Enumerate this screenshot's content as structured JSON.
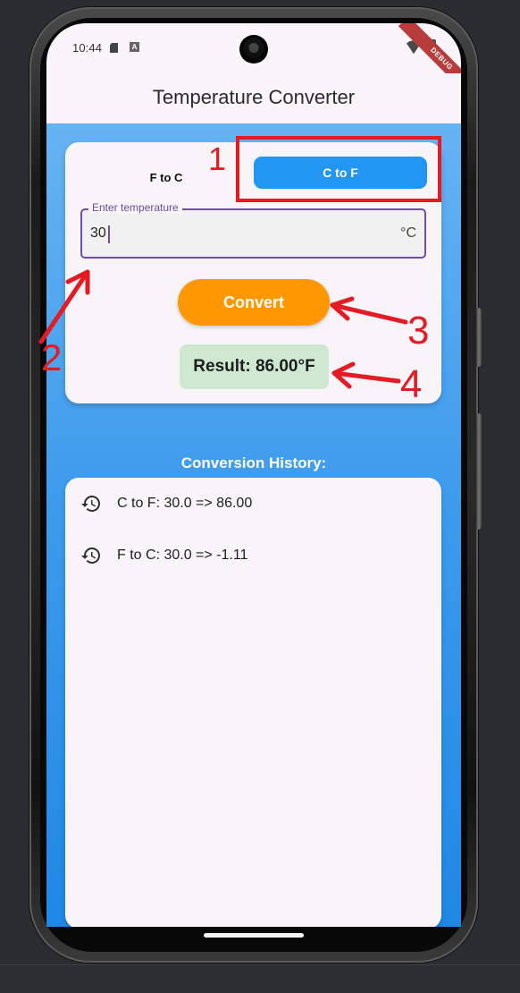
{
  "status_bar": {
    "time": "10:44",
    "sd_icon": "sd-card-icon",
    "notification_icon": "a-icon",
    "wifi_icon": "wifi-icon",
    "battery_icon": "battery-icon",
    "debug_banner": "DEBUG"
  },
  "app": {
    "title": "Temperature Converter",
    "background_top": "#66b3f3",
    "background_bottom": "#1f88e5"
  },
  "converter": {
    "mode_options": [
      {
        "label": "F to C",
        "selected": false
      },
      {
        "label": "C to F",
        "selected": true
      }
    ],
    "input_label": "Enter temperature",
    "input_value": "30",
    "unit": "°C",
    "convert_label": "Convert",
    "result": "Result: 86.00°F",
    "accent_blue": "#2196f3",
    "accent_orange": "#ff9800",
    "result_green": "#cfe8d1"
  },
  "history": {
    "title": "Conversion History:",
    "items": [
      {
        "text": "C to F: 30.0 => 86.00",
        "icon": "history-icon"
      },
      {
        "text": "F to C: 30.0 => -1.11",
        "icon": "history-icon"
      }
    ]
  },
  "annotations": {
    "marker_1": "1",
    "marker_2": "2",
    "marker_3": "3",
    "marker_4": "4",
    "color": "#e51b24"
  }
}
